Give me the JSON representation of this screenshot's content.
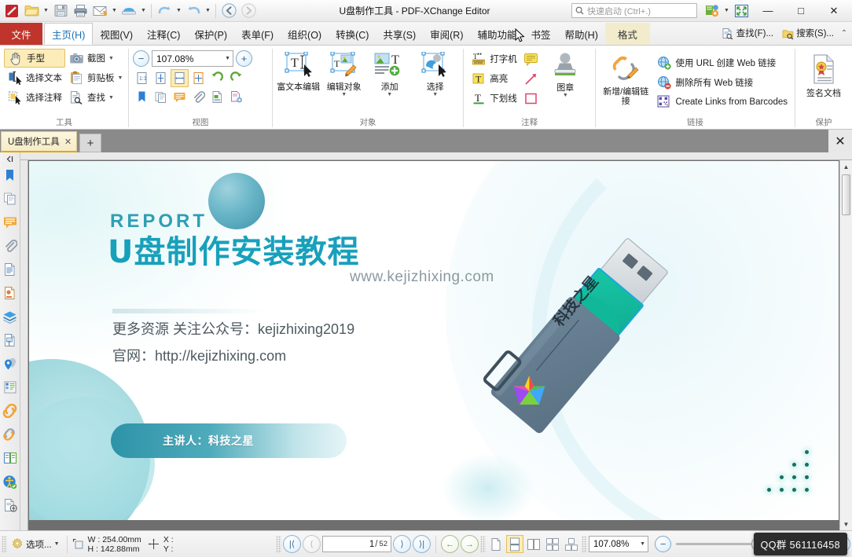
{
  "window": {
    "title": "U盘制作工具 - PDF-XChange Editor",
    "minimize": "—",
    "maximize": "□",
    "close": "✕"
  },
  "quick_access": {
    "items": [
      {
        "name": "app-icon",
        "label": "PDF-XChange"
      },
      {
        "name": "open-icon",
        "label": "打开"
      },
      {
        "name": "save-icon",
        "label": "保存"
      },
      {
        "name": "print-icon",
        "label": "打印"
      },
      {
        "name": "email-icon",
        "label": "电子邮件"
      },
      {
        "name": "scan-icon",
        "label": "扫描"
      },
      {
        "name": "undo-icon",
        "label": "撤销"
      },
      {
        "name": "redo-icon",
        "label": "重做"
      },
      {
        "name": "back-icon",
        "label": "后退"
      },
      {
        "name": "forward-icon",
        "label": "前进"
      }
    ]
  },
  "search": {
    "placeholder": "快速启动 (Ctrl+.)"
  },
  "tabs": {
    "file": "文件",
    "items": [
      {
        "label": "主页(H)",
        "active": true
      },
      {
        "label": "视图(V)",
        "active": false
      },
      {
        "label": "注释(C)",
        "active": false
      },
      {
        "label": "保护(P)",
        "active": false
      },
      {
        "label": "表单(F)",
        "active": false
      },
      {
        "label": "组织(O)",
        "active": false
      },
      {
        "label": "转换(C)",
        "active": false
      },
      {
        "label": "共享(S)",
        "active": false
      },
      {
        "label": "审阅(R)",
        "active": false
      },
      {
        "label": "辅助功能",
        "active": false
      },
      {
        "label": "书签",
        "active": false
      },
      {
        "label": "帮助(H)",
        "active": false
      }
    ],
    "format": "格式",
    "right_items": [
      {
        "label": "查找(F)...",
        "icon": "find-icon"
      },
      {
        "label": "搜索(S)...",
        "icon": "search-doc-icon"
      }
    ],
    "collapse": "⌃"
  },
  "ribbon": {
    "groups": [
      {
        "label": "工具",
        "buttons": [
          {
            "label": "手型",
            "icon": "hand-icon",
            "selected": true
          },
          {
            "label": "选择文本",
            "icon": "select-text-icon",
            "selected": false
          },
          {
            "label": "选择注释",
            "icon": "select-annotation-icon",
            "selected": false
          },
          {
            "label": "截图",
            "icon": "snapshot-icon",
            "dropdown": true
          },
          {
            "label": "剪贴板",
            "icon": "clipboard-icon",
            "dropdown": true
          },
          {
            "label": "查找",
            "icon": "find-icon",
            "dropdown": true
          }
        ]
      },
      {
        "label": "视图",
        "zoom_value": "107.08%",
        "zoom_out": "−",
        "zoom_in": "+",
        "icons": [
          {
            "name": "actual-size-icon"
          },
          {
            "name": "fit-page-icon"
          },
          {
            "name": "fit-width-icon",
            "selected": true
          },
          {
            "name": "fit-visible-icon"
          },
          {
            "name": "rotate-ccw-icon"
          },
          {
            "name": "rotate-cw-icon"
          },
          {
            "name": "bookmarks-icon"
          },
          {
            "name": "pages-panel-icon"
          },
          {
            "name": "comments-panel-icon"
          },
          {
            "name": "attachments-icon"
          },
          {
            "name": "content-panel-icon"
          },
          {
            "name": "properties-icon"
          }
        ]
      },
      {
        "label": "对象",
        "buttons": [
          {
            "label": "富文本编辑",
            "icon": "rich-text-edit-icon"
          },
          {
            "label": "编辑对象",
            "icon": "edit-object-icon",
            "dropdown": true
          },
          {
            "label": "添加",
            "icon": "add-object-icon",
            "dropdown": true
          },
          {
            "label": "选择",
            "icon": "select-object-icon",
            "dropdown": true
          }
        ]
      },
      {
        "label": "注释",
        "buttons": [
          {
            "label": "打字机",
            "icon": "typewriter-icon"
          },
          {
            "label": "高亮",
            "icon": "highlight-icon"
          },
          {
            "label": "下划线",
            "icon": "underline-icon"
          },
          {
            "label": "",
            "icon": "sticky-note-icon"
          },
          {
            "label": "",
            "icon": "arrow-annotation-icon"
          },
          {
            "label": "",
            "icon": "rectangle-annotation-icon"
          },
          {
            "label": "图章",
            "icon": "stamp-icon",
            "dropdown": true
          }
        ]
      },
      {
        "label": "链接",
        "buttons": [
          {
            "label": "新增/编辑链接",
            "icon": "edit-link-icon"
          },
          {
            "label": "使用 URL 创建 Web 链接",
            "icon": "create-web-link-icon"
          },
          {
            "label": "删除所有 Web 链接",
            "icon": "remove-web-link-icon"
          },
          {
            "label": "Create Links from Barcodes",
            "icon": "barcode-link-icon"
          }
        ]
      },
      {
        "label": "保护",
        "buttons": [
          {
            "label": "签名文档",
            "icon": "sign-document-icon"
          }
        ]
      }
    ]
  },
  "doc_tabs": {
    "items": [
      {
        "label": "U盘制作工具",
        "close": "✕"
      }
    ],
    "new_tab": "+",
    "close_doc": "✕"
  },
  "left_panel_icons": [
    {
      "name": "bookmarks-panel-icon"
    },
    {
      "name": "thumbnails-panel-icon"
    },
    {
      "name": "comments-panel-icon"
    },
    {
      "name": "attachments-panel-icon"
    },
    {
      "name": "content-panel-icon"
    },
    {
      "name": "stamps-panel-icon"
    },
    {
      "name": "layers-panel-icon"
    },
    {
      "name": "fields-panel-icon"
    },
    {
      "name": "destinations-panel-icon"
    },
    {
      "name": "signatures-panel-icon"
    },
    {
      "name": "links-panel-icon"
    },
    {
      "name": "redaction-panel-icon"
    },
    {
      "name": "compare-panel-icon"
    },
    {
      "name": "accessibility-panel-icon"
    },
    {
      "name": "export-panel-icon"
    }
  ],
  "slide": {
    "report_word": "REPORT",
    "title": "U盘制作安装教程",
    "website": "www.kejizhixing.com",
    "line1": "更多资源 关注公众号：kejizhixing2019",
    "line2": "官网：http://kejizhixing.com",
    "speaker": "主讲人：科技之星",
    "usb_label": "科技之星",
    "accent_color": "#18a0bb",
    "accent_color2": "#2f9fb4"
  },
  "status": {
    "options_label": "选项...",
    "width_label": "W : 254.00mm",
    "height_label": "H : 142.88mm",
    "x_label": "X :",
    "y_label": "Y :",
    "first_page": "|⟨",
    "prev_page": "⟨",
    "next_page": "⟩",
    "last_page": "⟩|",
    "page_current": "1",
    "page_slash": "/",
    "page_total": "52",
    "back_nav": "←",
    "forward_nav": "→",
    "view_modes": [
      {
        "name": "single-page-icon",
        "selected": false
      },
      {
        "name": "continuous-page-icon",
        "selected": true
      },
      {
        "name": "two-page-icon",
        "selected": false
      },
      {
        "name": "two-page-continuous-icon",
        "selected": false
      },
      {
        "name": "two-page-cover-icon",
        "selected": false
      }
    ],
    "zoom_value": "107.08%",
    "zoom_out": "−",
    "zoom_in": "+"
  },
  "tooltip": {
    "qq_group": "QQ群 561116458"
  }
}
